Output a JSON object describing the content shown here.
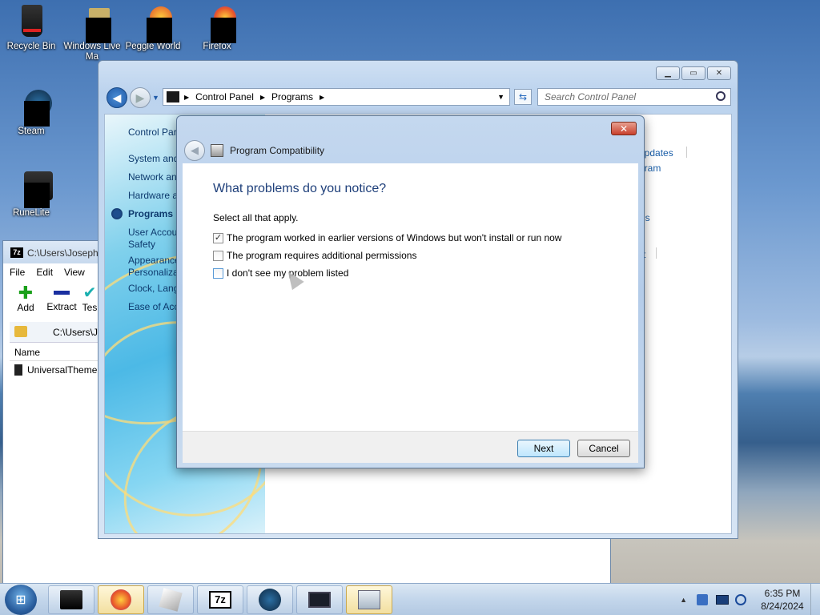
{
  "desktop_icons": [
    {
      "label": "Recycle Bin"
    },
    {
      "label": "Windows Live Ma"
    },
    {
      "label": "Peggle World"
    },
    {
      "label": "Firefox"
    },
    {
      "label": "Steam"
    },
    {
      "label": "RuneLite"
    }
  ],
  "control_panel": {
    "breadcrumb": [
      "Control Panel",
      "Programs"
    ],
    "search_placeholder": "Search Control Panel",
    "left_nav": [
      "Control Par",
      "System and",
      "Network and",
      "Hardware a",
      "Programs",
      "User Accou",
      "Safety",
      "Appearance",
      "Personalizat",
      "Clock, Lang",
      "Ease of Acc"
    ],
    "right_links": [
      "updates",
      "gram",
      "ns",
      "t"
    ]
  },
  "zip": {
    "title": "C:\\Users\\Joseph",
    "menu": [
      "File",
      "Edit",
      "View"
    ],
    "tools": [
      "Add",
      "Extract",
      "Tes"
    ],
    "path": "C:\\Users\\J",
    "column_name": "Name",
    "file_name": "UniversalThemeP"
  },
  "dialog": {
    "title": "Program Compatibility",
    "heading": "What problems do you notice?",
    "subtext": "Select all that apply.",
    "options": [
      {
        "label": "The program worked in earlier versions of Windows but won't install or run now",
        "checked": true
      },
      {
        "label": "The program requires additional permissions",
        "checked": false
      },
      {
        "label": "I don't see my problem listed",
        "checked": false
      }
    ],
    "next_label": "Next",
    "cancel_label": "Cancel",
    "close_glyph": "✕"
  },
  "taskbar": {
    "time": "6:35 PM",
    "date": "8/24/2024",
    "apps": [
      "explorer",
      "firefox",
      "unknown",
      "7-zip",
      "steam",
      "runelite",
      "control-panel"
    ]
  },
  "colors": {
    "dialog_heading": "#1e3f7a",
    "link": "#1a5ea8",
    "close_button": "#c8402c"
  }
}
